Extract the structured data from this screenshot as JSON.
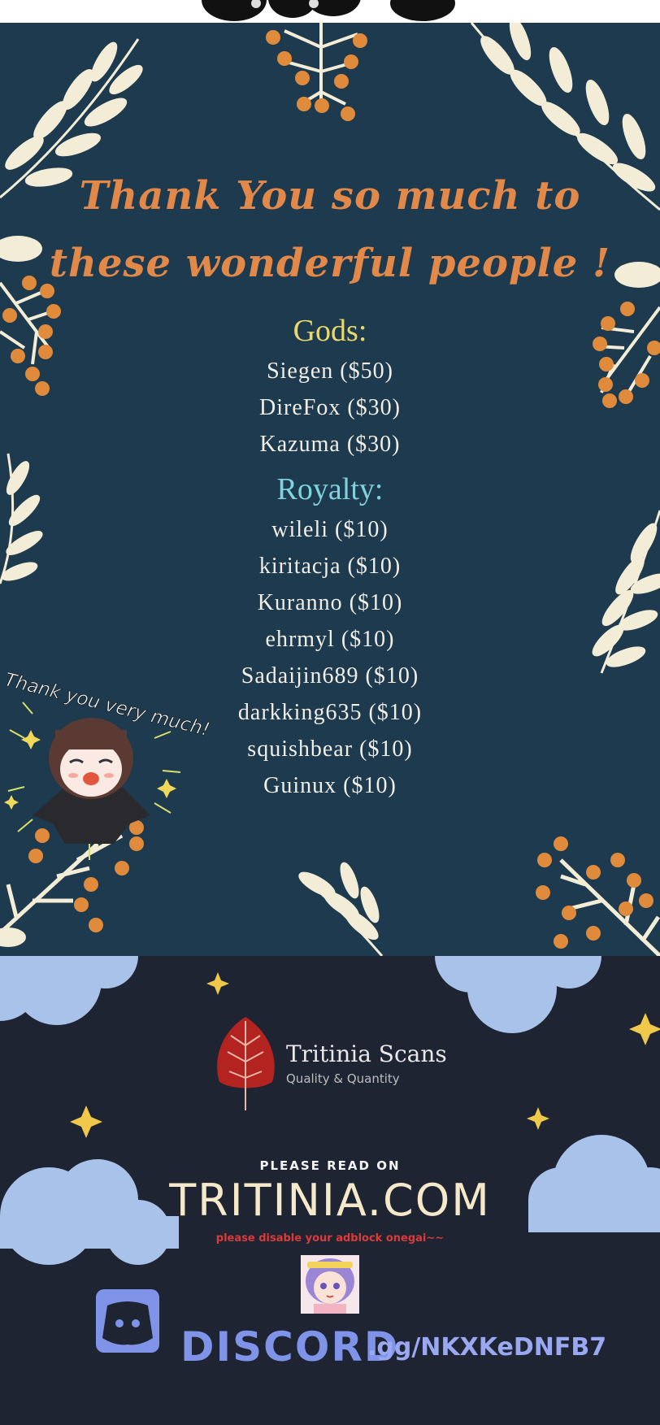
{
  "credits": {
    "headline_line1": "Thank You so much to",
    "headline_line2": "these wonderful people !",
    "gods_label": "Gods:",
    "gods": [
      "Siegen ($50)",
      "DireFox ($30)",
      "Kazuma ($30)"
    ],
    "royalty_label": "Royalty:",
    "royalty": [
      "wileli ($10)",
      "kiritacja ($10)",
      "Kuranno ($10)",
      "ehrmyl ($10)",
      "Sadaijin689 ($10)",
      "darkking635 ($10)",
      "squishbear ($10)",
      "Guinux ($10)"
    ],
    "sticker_caption": "Thank you very much!"
  },
  "promo": {
    "brand_name": "Tritinia Scans",
    "brand_tagline": "Quality & Quantity",
    "read_on": "PLEASE READ ON",
    "site": "TRITINIA.COM",
    "adblock_note": "please disable your adblock onegai~~",
    "discord_word": "DISCORD",
    "discord_code": ".gg/NKXKeDNFB7"
  },
  "colors": {
    "panel_bg": "#1d3a4e",
    "promo_bg": "#1f2433",
    "headline": "#e2894a",
    "gods": "#e9d86a",
    "royalty": "#7fd3dc",
    "name_text": "#f1eee6",
    "berry": "#e08a3c",
    "leaf": "#f3ecd6",
    "cloud": "#a8c2ea",
    "discord": "#7f93e8",
    "brand_leaf": "#b3231f"
  }
}
